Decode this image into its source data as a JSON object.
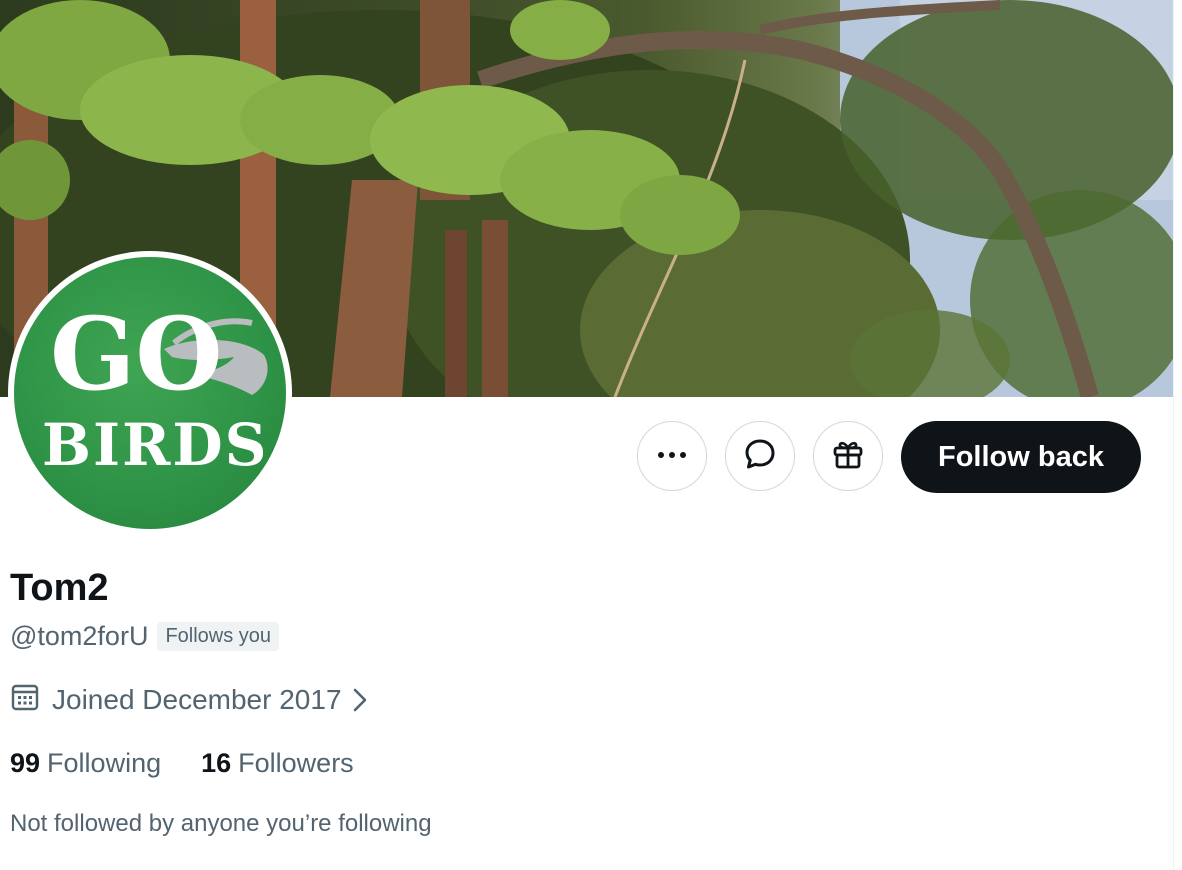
{
  "profile": {
    "display_name": "Tom2",
    "handle": "@tom2forU",
    "follows_you_label": "Follows you",
    "joined": "Joined December 2017",
    "following_count": "99",
    "following_label": "Following",
    "followers_count": "16",
    "followers_label": "Followers",
    "mutuals_text": "Not followed by anyone you’re following"
  },
  "avatar": {
    "text_line1": "GO",
    "text_line2": "BIRDS",
    "background_color": "#2f9447"
  },
  "actions": {
    "more_icon": "more-horizontal-icon",
    "message_icon": "message-bubble-icon",
    "gift_icon": "gift-icon",
    "follow_label": "Follow back"
  },
  "icons": {
    "joined": "calendar-icon",
    "joined_chevron": "chevron-right-icon"
  },
  "colors": {
    "primary_text": "#0f1419",
    "secondary_text": "#536471",
    "follow_button": "#0f1419",
    "badge_bg": "#eff3f4"
  }
}
